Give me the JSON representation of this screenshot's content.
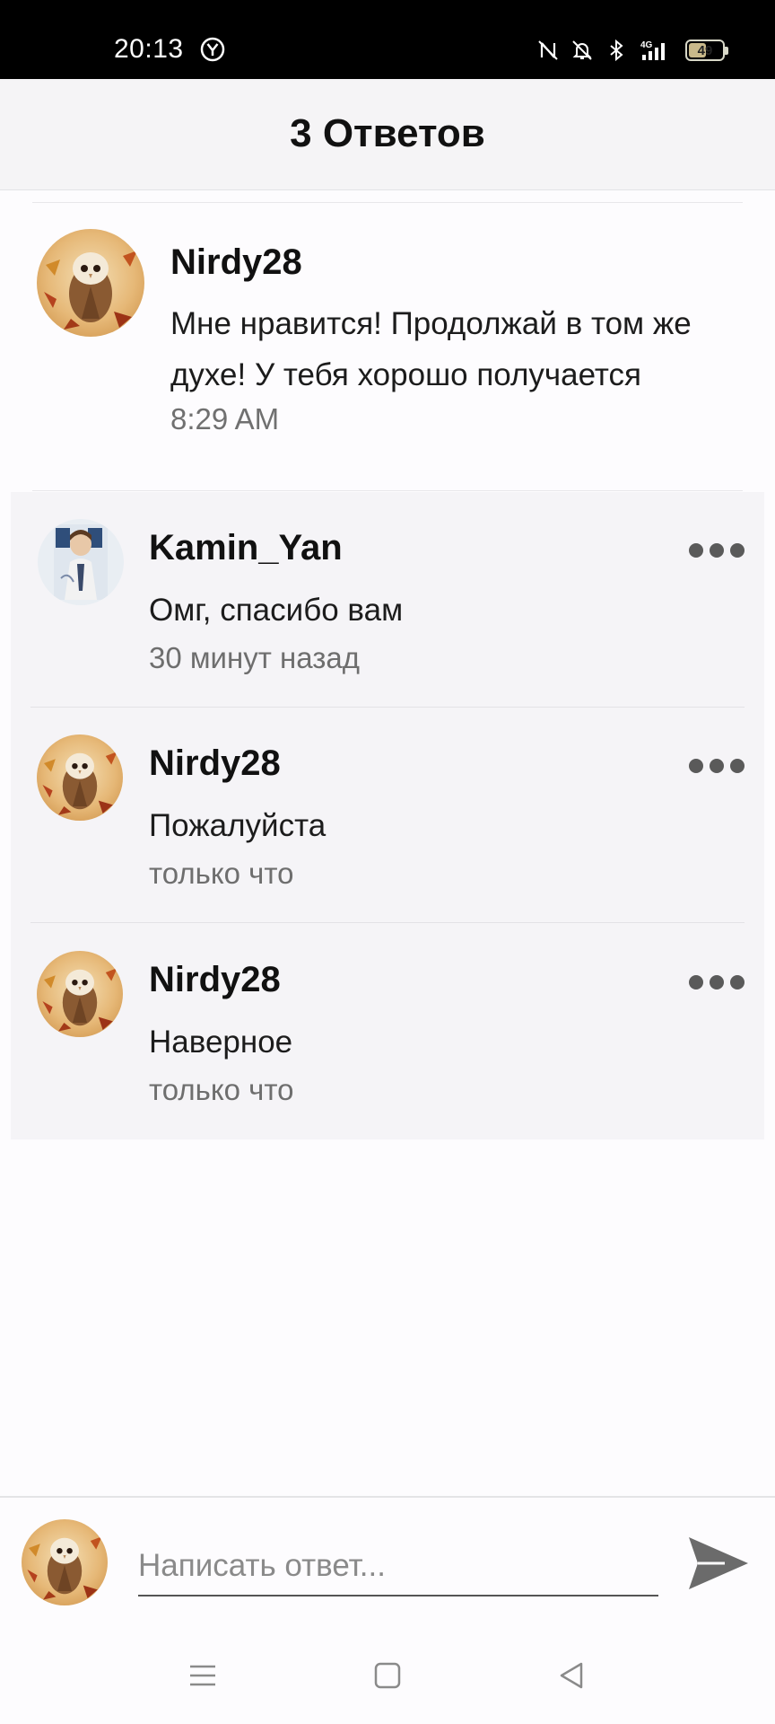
{
  "status_bar": {
    "time": "20:13",
    "battery": "49",
    "icons": [
      "y-circle-icon",
      "nfc-icon",
      "bell-off-icon",
      "bluetooth-icon",
      "signal-4g-icon",
      "battery-icon"
    ]
  },
  "header": {
    "title": "3 Ответов"
  },
  "parent_comment": {
    "author": "Nirdy28",
    "text": "Мне нравится! Продолжай в том же духе! У тебя хорошо получается",
    "time": "8:29 AM",
    "avatar": "owl-avatar"
  },
  "replies": [
    {
      "author": "Kamin_Yan",
      "text": "Омг, спасибо вам",
      "time": "30 минут назад",
      "avatar": "anime-avatar",
      "more_icon": "more-horizontal-icon"
    },
    {
      "author": "Nirdy28",
      "text": "Пожалуйста",
      "time": "только что",
      "avatar": "owl-avatar",
      "more_icon": "more-horizontal-icon"
    },
    {
      "author": "Nirdy28",
      "text": "Наверное",
      "time": "только что",
      "avatar": "owl-avatar",
      "more_icon": "more-horizontal-icon"
    }
  ],
  "composer": {
    "placeholder": "Написать ответ...",
    "value": "",
    "send_icon": "send-icon",
    "avatar": "owl-avatar"
  },
  "nav_bar": {
    "icons": [
      "menu-icon",
      "home-square-icon",
      "back-triangle-icon"
    ]
  },
  "colors": {
    "status_bg": "#000000",
    "header_bg": "#f5f4f6",
    "replies_bg": "#f5f4f7",
    "text_primary": "#111111",
    "text_secondary": "#6e6e6e"
  }
}
